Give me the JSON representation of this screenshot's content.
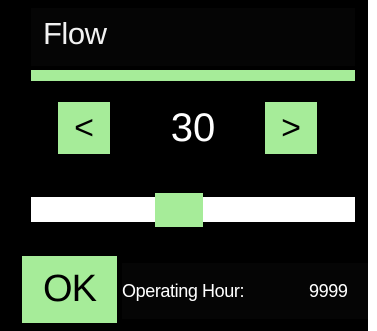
{
  "title": "Flow",
  "stepper": {
    "decrement_label": "<",
    "value": "30",
    "increment_label": ">"
  },
  "slider": {
    "level": 0.45
  },
  "footer": {
    "ok_label": "OK",
    "operating_hour_label": "Operating Hour:",
    "operating_hour_value": "9999"
  },
  "colors": {
    "accent": "#a6ec99",
    "background": "#000000",
    "track": "#ffffff",
    "text": "#ffffff"
  }
}
